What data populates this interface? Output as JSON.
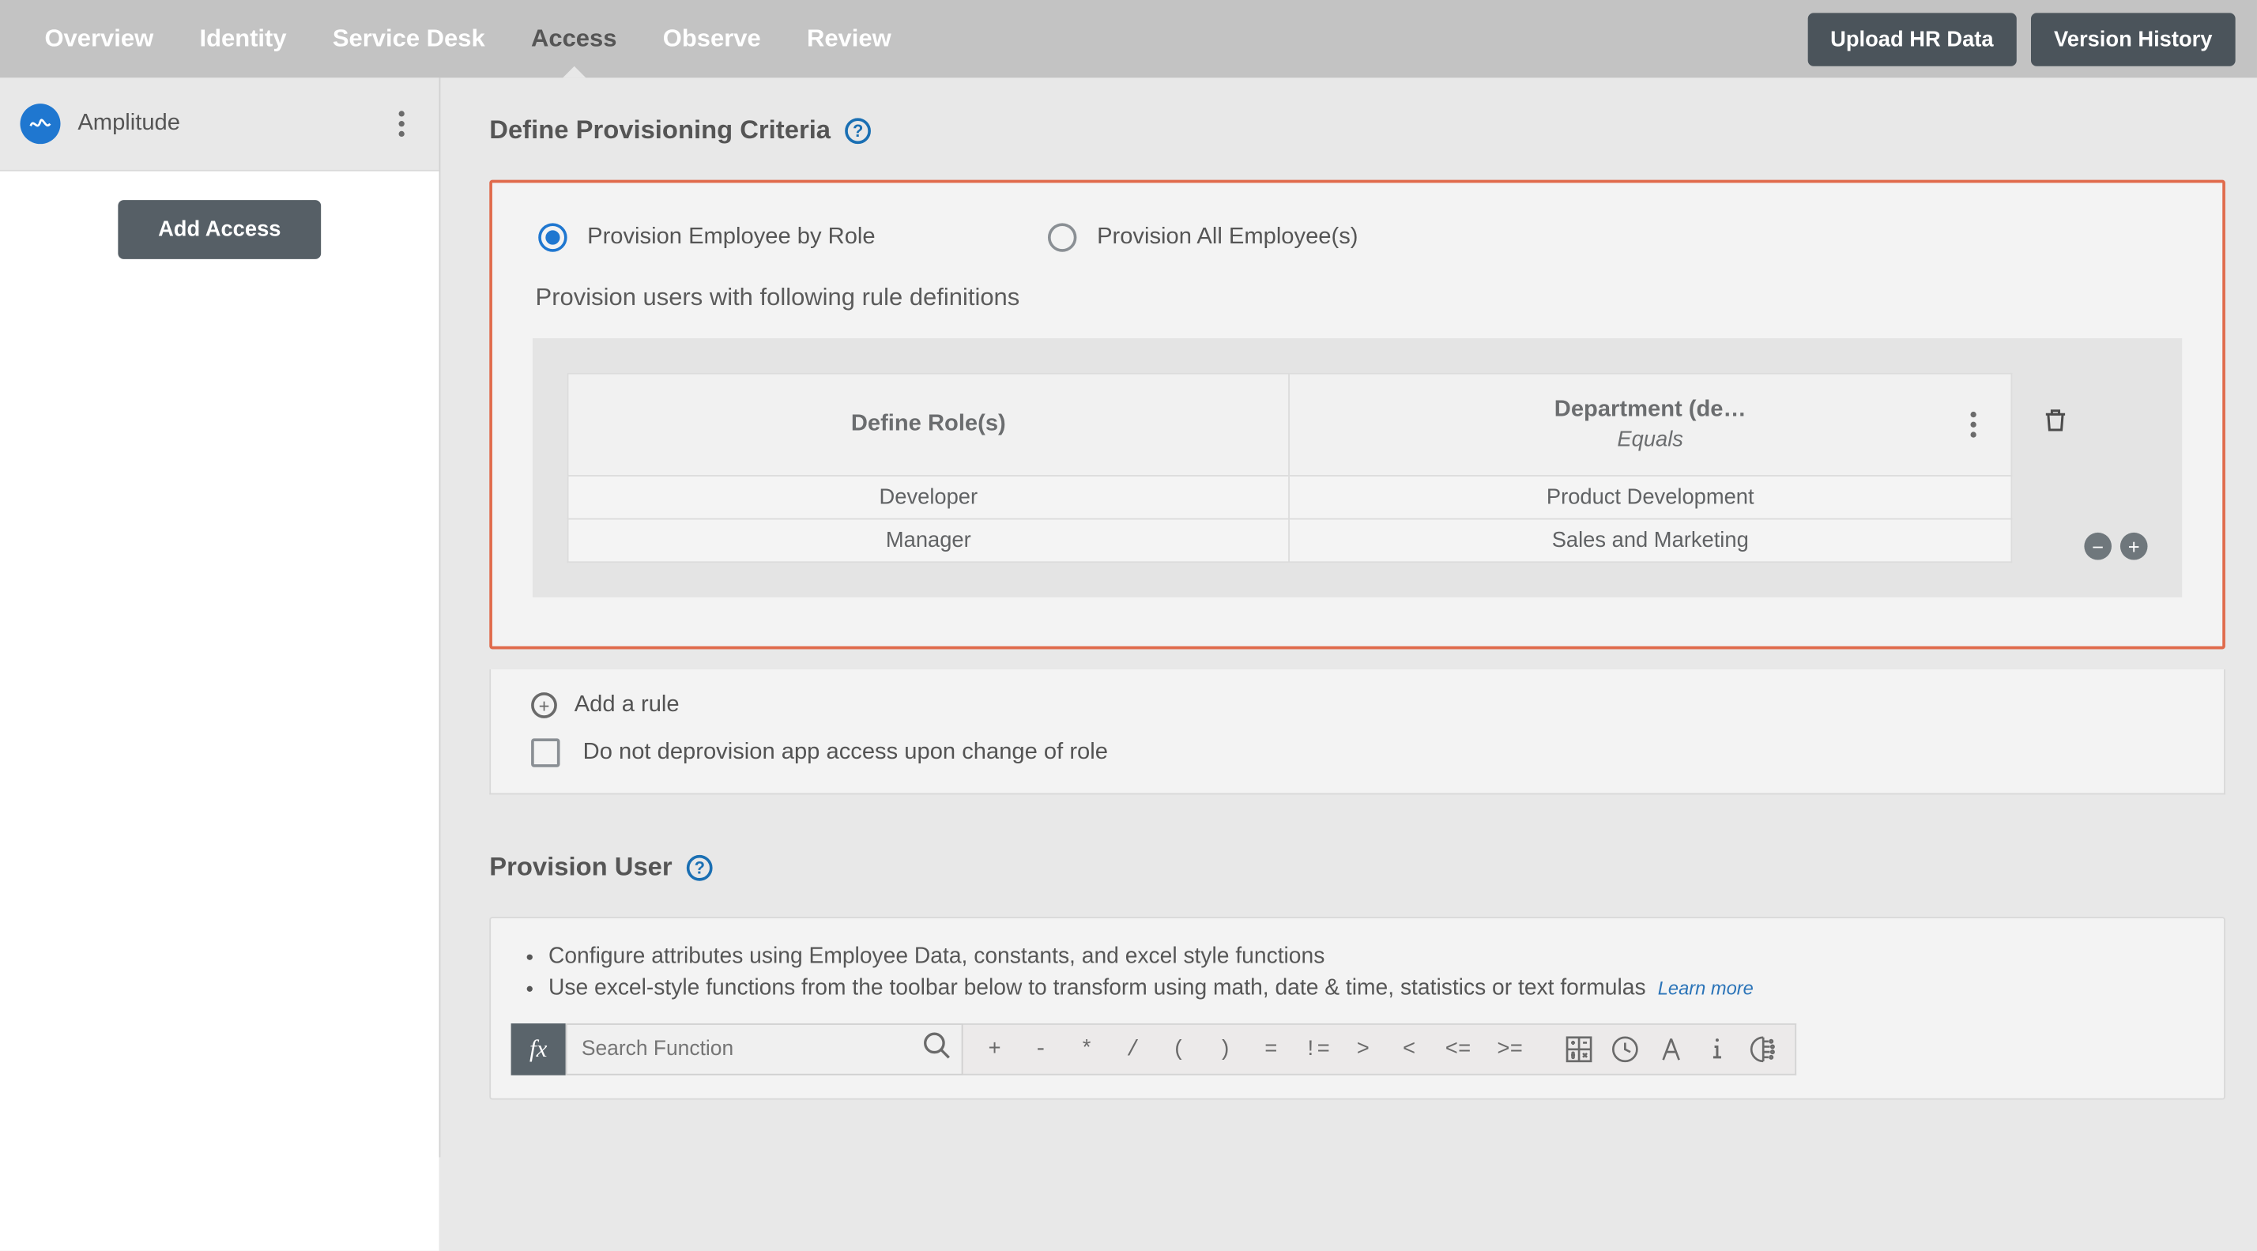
{
  "nav": {
    "items": [
      {
        "label": "Overview",
        "active": false
      },
      {
        "label": "Identity",
        "active": false
      },
      {
        "label": "Service Desk",
        "active": false
      },
      {
        "label": "Access",
        "active": true
      },
      {
        "label": "Observe",
        "active": false
      },
      {
        "label": "Review",
        "active": false
      }
    ],
    "upload_btn": "Upload HR Data",
    "history_btn": "Version History"
  },
  "sidebar": {
    "app_name": "Amplitude",
    "add_access_btn": "Add Access"
  },
  "section_criteria": {
    "heading": "Define Provisioning Criteria",
    "radio_by_role": "Provision Employee by Role",
    "radio_all": "Provision All Employee(s)",
    "rule_intro": "Provision users with following rule definitions",
    "table": {
      "col1_header": "Define Role(s)",
      "col2_header_top": "Department (de…",
      "col2_header_sub": "Equals",
      "rows": [
        {
          "role": "Developer",
          "value": "Product Development"
        },
        {
          "role": "Manager",
          "value": "Sales and Marketing"
        }
      ]
    },
    "add_rule_label": "Add a rule",
    "no_deprovision_label": "Do not deprovision app access upon change of role"
  },
  "section_user": {
    "heading": "Provision User",
    "bullet1": "Configure attributes using Employee Data, constants, and excel style functions",
    "bullet2": "Use excel-style functions from the toolbar below to transform using math, date & time, statistics or text formulas",
    "learn_more": "Learn more",
    "fx_label": "fx",
    "search_placeholder": "Search Function",
    "operators": [
      "+",
      "-",
      "*",
      "/",
      "(",
      ")",
      "=",
      "!=",
      ">",
      "<",
      "<=",
      ">="
    ]
  }
}
